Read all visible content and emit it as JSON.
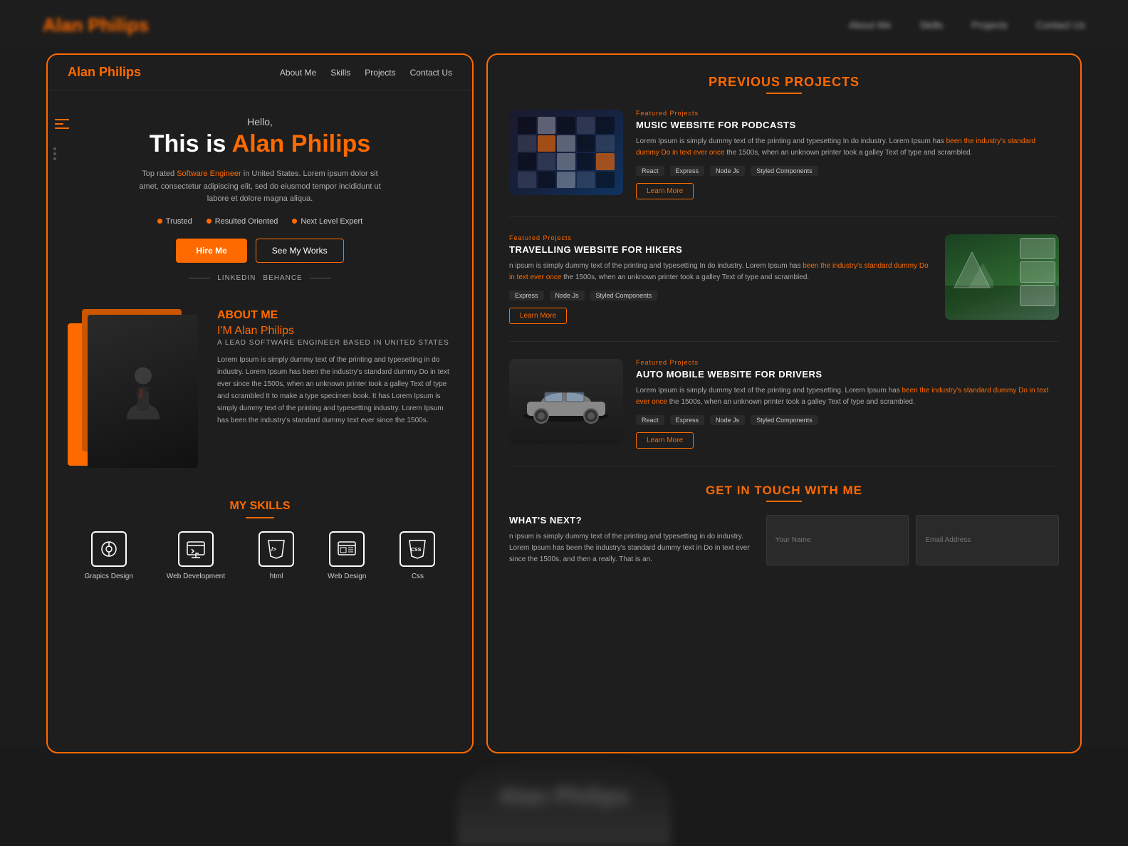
{
  "meta": {
    "title": "Alan Philips Portfolio"
  },
  "topNav": {
    "logo": "Alan Philips",
    "links": [
      "About Me",
      "Skills",
      "Projects",
      "Contact Us"
    ]
  },
  "leftPanel": {
    "nav": {
      "logo_first": "Alan",
      "logo_second": " Philips",
      "links": [
        "About Me",
        "Skills",
        "Projects",
        "Contact Us"
      ]
    },
    "hero": {
      "greeting": "Hello,",
      "title_pre": "This is ",
      "title_name": "Alan Philips",
      "description": "Top rated Software Engineer in United States. Lorem ipsum dolor sit amet, consectetur adipiscing elit, sed do eiusmod tempor incididunt ut labore et dolore magna aliqua.",
      "highlighted": "Software Engineer",
      "badges": [
        "Trusted",
        "Resulted Oriented",
        "Next Level Expert"
      ],
      "btn_hire": "Hire Me",
      "btn_works": "See My Works",
      "social_links": [
        "LINKEDIN",
        "BEHANCE"
      ]
    },
    "about": {
      "section_title_white": "ABOUT",
      "section_title_orange": " ME",
      "name_pre": "I'M  ",
      "name": "Alan Philips",
      "role": "A LEAD SOFTWARE ENGINEER  BASED IN UNITED STATES",
      "description": "Lorem Ipsum is simply dummy text of the printing and typesetting in do industry. Lorem Ipsum has been the industry's standard dummy Do in text ever since the 1500s, when an unknown printer took a galley Text of type and scrambled It to make a type specimen book. It has Lorem Ipsum is simply dummy text of the printing and typesetting industry. Lorem Ipsum has been the industry's standard dummy text ever since the 1500s."
    },
    "skills": {
      "title_white": "MY",
      "title_orange": " SKILLS",
      "items": [
        {
          "icon": "🎨",
          "label": "Grapics Design"
        },
        {
          "icon": "💻",
          "label": "Web Development"
        },
        {
          "icon": "📄",
          "label": "html"
        },
        {
          "icon": "🖥️",
          "label": "Web Design"
        },
        {
          "icon": "🎨",
          "label": "Css"
        }
      ]
    }
  },
  "rightPanel": {
    "projects": {
      "title_white": "PREVIOUS",
      "title_orange": " PROJECTS",
      "items": [
        {
          "tag": "Featured Projects",
          "name": "MUSIC WEBSITE FOR PODCASTS",
          "description": "Lorem Ipsum is simply dummy text of the printing and typesetting In do industry. Lorem Ipsum has been the industry's standard dummy Do in text ever since the 1500s, when an unknown printer took a galley Text of type and scrambled.",
          "highlighted": "been the industry's standard dummy Do in text ever once",
          "techs": [
            "React",
            "Express",
            "Node Js",
            "Styled Components"
          ],
          "btn": "Learn More",
          "thumb_type": "music"
        },
        {
          "tag": "Featured Projects",
          "name": "TRAVELLING WEBSITE FOR HIKERS",
          "description": "n Ipsum is simply dummy text of the printing and typesetting In do industry. Lorem Ipsum has been the industry's standard dummy Do in text ever since the 1500s, when an unknown printer took a galley Text of type and scrambled.",
          "highlighted": "been the industry's standard dummy Do in text ever once",
          "techs": [
            "Express",
            "Node Js",
            "Styled Components"
          ],
          "btn": "Learn More",
          "thumb_type": "hiking"
        },
        {
          "tag": "Featured Projects",
          "name": "AUTO MOBILE WEBSITE FOR DRIVERS",
          "description": "Lorem Ipsum is simply dummy text of the printing and typesetting. Lorem Ipsum has been the industry's standard dummy Do in text ever once the 1500s, when an unknown printer took a galley Text of type and scrambled.",
          "highlighted": "been the industry's standard dummy Do in text ever once",
          "techs": [
            "React",
            "Express",
            "Node Js",
            "Styled Components"
          ],
          "btn": "Learn More",
          "thumb_type": "auto"
        }
      ]
    },
    "contact": {
      "title_white": "GET IN TOUCH",
      "title_orange": " WITH ME",
      "next_label": "WHAT'S NEXT?",
      "next_desc": "n ipsum is simply dummy text of the printing and typesetting in do industry. Lorem Ipsum has been the industry's standard dummy text in Do in text ever since the 1500s, and then a really. That is an.",
      "field_name": "Your Name",
      "field_email": "Email Address"
    }
  },
  "bottomText": "Alan Philips"
}
